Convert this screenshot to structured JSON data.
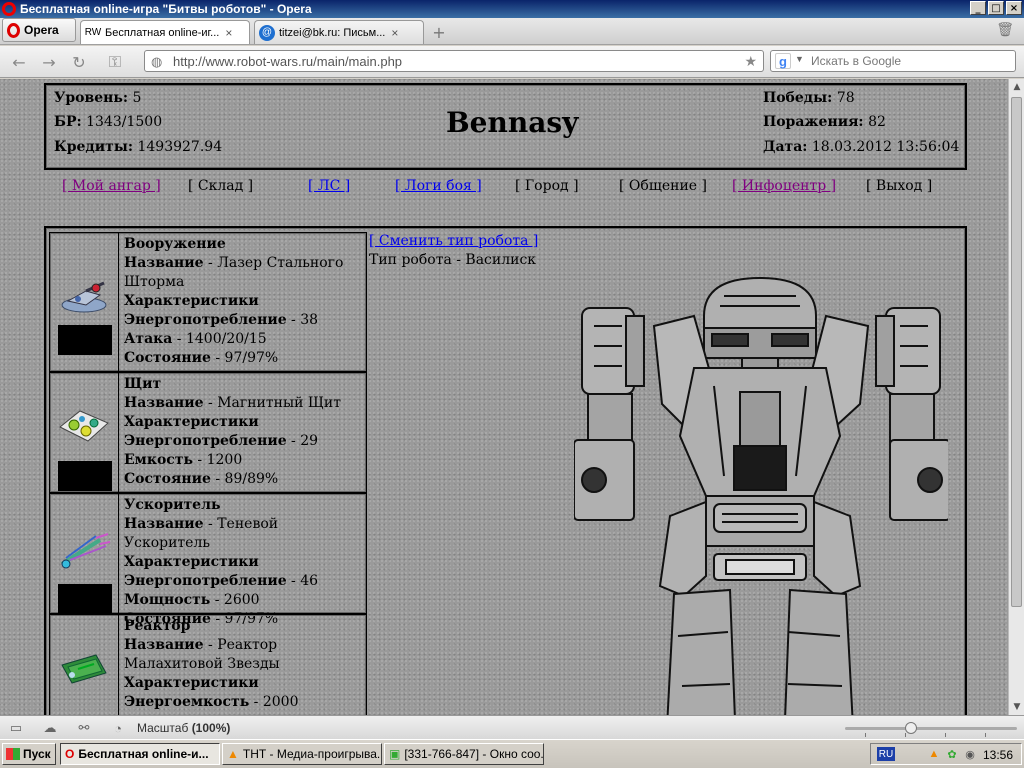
{
  "window": {
    "title": "Бесплатная online-игра \"Битвы роботов\" - Opera",
    "min": "_",
    "max": "□",
    "close": "×"
  },
  "browser": {
    "menu_label": "Opera",
    "tabs": [
      {
        "label": "Бесплатная online-иг...",
        "favicon": "RW",
        "active": true
      },
      {
        "label": "titzei@bk.ru: Письм...",
        "favicon": "@",
        "active": false
      }
    ],
    "url": "http://www.robot-wars.ru/main/main.php",
    "search_placeholder": "Искать в Google"
  },
  "page": {
    "stats_left": [
      {
        "label": "Уровень:",
        "value": "5"
      },
      {
        "label": "БР:",
        "value": "1343/1500"
      },
      {
        "label": "Кредиты:",
        "value": "1493927.94"
      }
    ],
    "username": "Bennasy",
    "stats_right": [
      {
        "label": "Победы:",
        "value": "78"
      },
      {
        "label": "Поражения:",
        "value": "82"
      },
      {
        "label": "Дата:",
        "value": "18.03.2012 13:56:04"
      }
    ],
    "menu": [
      {
        "label": "[ Мой ангар ]",
        "kind": "visited"
      },
      {
        "label": "[ Склад ]",
        "kind": "plain"
      },
      {
        "label": "[ ЛС ]",
        "kind": "link"
      },
      {
        "label": "[ Логи боя ]",
        "kind": "link"
      },
      {
        "label": "[ Город ]",
        "kind": "plain"
      },
      {
        "label": "[ Общение ]",
        "kind": "plain"
      },
      {
        "label": "[ Инфоцентр ]",
        "kind": "visited"
      },
      {
        "label": "[ Выход ]",
        "kind": "plain"
      }
    ],
    "change_robot_link": "[ Сменить тип робота ]",
    "robot_type": "Тип робота - Василиск",
    "items": [
      {
        "icon": "laser-icon",
        "lines": [
          {
            "b": "Вооружение",
            "t": ""
          },
          {
            "b": "Название",
            "t": " - Лазер Стального Шторма"
          },
          {
            "b": "Характеристики",
            "t": ""
          },
          {
            "b": "Энергопотребление",
            "t": " - 38"
          },
          {
            "b": "Атака",
            "t": " - 1400/20/15"
          },
          {
            "b": "Состояние",
            "t": " - 97/97%"
          }
        ]
      },
      {
        "icon": "shield-icon",
        "lines": [
          {
            "b": "Щит",
            "t": ""
          },
          {
            "b": "Название",
            "t": " - Магнитный Щит"
          },
          {
            "b": "Характеристики",
            "t": ""
          },
          {
            "b": "Энергопотребление",
            "t": " - 29"
          },
          {
            "b": "Емкость",
            "t": " - 1200"
          },
          {
            "b": "Состояние",
            "t": " - 89/89%"
          }
        ]
      },
      {
        "icon": "booster-icon",
        "lines": [
          {
            "b": "Ускоритель",
            "t": ""
          },
          {
            "b": "Название",
            "t": " - Теневой Ускоритель"
          },
          {
            "b": "Характеристики",
            "t": ""
          },
          {
            "b": "Энергопотребление",
            "t": " - 46"
          },
          {
            "b": "Мощность",
            "t": " - 2600"
          },
          {
            "b": "Состояние",
            "t": " - 97/97%"
          }
        ]
      },
      {
        "icon": "reactor-icon",
        "lines": [
          {
            "b": "Реактор",
            "t": ""
          },
          {
            "b": "Название",
            "t": " - Реактор Малахитовой Звезды"
          },
          {
            "b": "Характеристики",
            "t": ""
          },
          {
            "b": "Энергоемкость",
            "t": " - 2000"
          }
        ]
      }
    ]
  },
  "statusbar": {
    "zoom_label": "Масштаб",
    "zoom_value": "(100%)",
    "zoom_level": 100
  },
  "taskbar": {
    "start_label": "Пуск",
    "buttons": [
      {
        "label": "Бесплатная online-и...",
        "active": true
      },
      {
        "label": "ТНТ - Медиа-проигрыва...",
        "active": false
      },
      {
        "label": "[331-766-847] - Окно соо...",
        "active": false
      }
    ],
    "lang": "RU",
    "clock": "13:56"
  }
}
